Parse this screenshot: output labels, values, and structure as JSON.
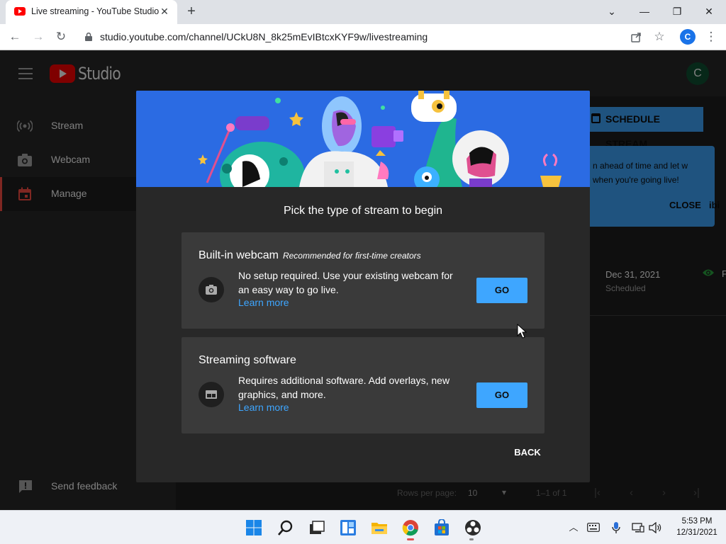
{
  "browser": {
    "tab_title": "Live streaming - YouTube Studio",
    "tab_close": "✕",
    "new_tab": "+",
    "url": "studio.youtube.com/channel/UCkU8N_8k25mEvIBtcxKYF9w/livestreaming",
    "profile_initial": "C",
    "window_controls": {
      "minimize": "—",
      "restore": "❐",
      "close": "✕",
      "tab_search": "⌄"
    }
  },
  "studio": {
    "logo_text": "Studio",
    "channel_initial": "C",
    "sidebar": {
      "items": [
        {
          "label": "Stream",
          "icon": "broadcast-icon"
        },
        {
          "label": "Webcam",
          "icon": "camera-icon"
        },
        {
          "label": "Manage",
          "icon": "calendar-icon",
          "active": true
        }
      ],
      "feedback_label": "Send feedback"
    },
    "schedule_button": "SCHEDULE STREAM",
    "tooltip": {
      "text": "n ahead of time and let w when you're going live!",
      "close": "CLOSE",
      "overflow_text": "ibi"
    },
    "table_row": {
      "date": "Dec 31, 2021",
      "status": "Scheduled",
      "visibility_initial": "F"
    },
    "pagination": {
      "rows_label": "Rows per page:",
      "rows_value": "10",
      "range": "1–1 of 1"
    }
  },
  "dialog": {
    "title": "Pick the type of stream to begin",
    "options": [
      {
        "title": "Built-in webcam",
        "note": "Recommended for first-time creators",
        "description": "No setup required. Use your existing webcam for an easy way to go live.",
        "link": "Learn more",
        "button": "GO",
        "icon": "camera-icon"
      },
      {
        "title": "Streaming software",
        "note": "",
        "description": "Requires additional software. Add overlays, new graphics, and more.",
        "link": "Learn more",
        "button": "GO",
        "icon": "software-window-icon"
      }
    ],
    "back_button": "BACK"
  },
  "taskbar": {
    "apps": [
      "start-icon",
      "search-icon",
      "task-view-icon",
      "widgets-icon",
      "file-explorer-icon",
      "chrome-icon",
      "store-icon",
      "obs-icon"
    ],
    "clock_time": "5:53 PM",
    "clock_date": "12/31/2021"
  },
  "colors": {
    "accent_blue": "#3ea6ff",
    "youtube_red": "#ff0000",
    "dialog_bg": "#282828",
    "card_bg": "#3a3a3a"
  }
}
